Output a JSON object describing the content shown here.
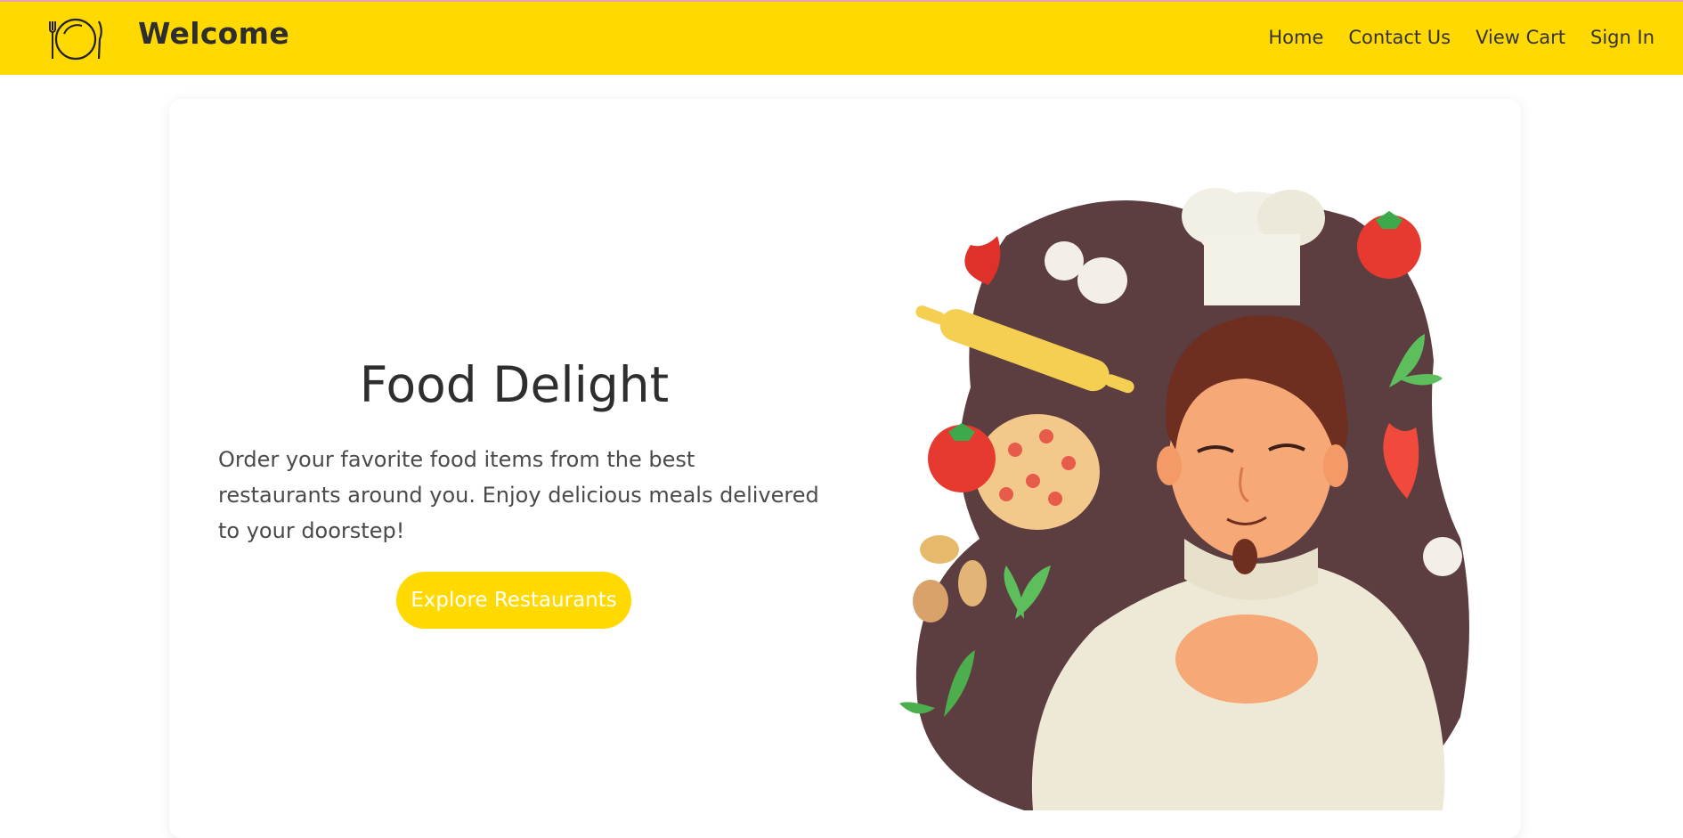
{
  "header": {
    "brand": "Welcome",
    "logo_icon": "plate-fork-knife-icon",
    "nav": [
      "Home",
      "Contact Us",
      "View Cart",
      "Sign In"
    ]
  },
  "hero": {
    "title": "Food Delight",
    "description": "Order your favorite food items from the best restaurants around you. Enjoy delicious meals delivered to your doorstep!",
    "cta_label": "Explore Restaurants",
    "illustration": "chef-illustration"
  },
  "colors": {
    "accent": "#ffd900",
    "text": "#2e2e2e",
    "blob": "#5c3d40"
  }
}
